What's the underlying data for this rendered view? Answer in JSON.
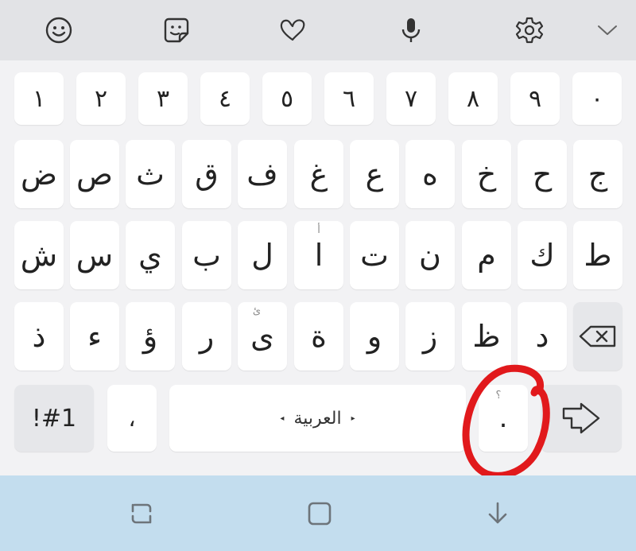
{
  "toolbar": {
    "icons": [
      "emoji-icon",
      "sticker-icon",
      "heart-doodle-icon",
      "microphone-icon",
      "settings-gear-icon",
      "collapse-chevron-icon"
    ]
  },
  "keyboard": {
    "numbers": [
      "١",
      "٢",
      "٣",
      "٤",
      "٥",
      "٦",
      "٧",
      "٨",
      "٩",
      "٠"
    ],
    "row1": [
      "ض",
      "ص",
      "ث",
      "ق",
      "ف",
      "غ",
      "ع",
      "ه",
      "خ",
      "ح",
      "ج"
    ],
    "row2": [
      "ش",
      "س",
      "ي",
      "ب",
      "ل",
      "ا",
      "ت",
      "ن",
      "م",
      "ك",
      "ط"
    ],
    "row2_hint_alef": "أ",
    "row3": [
      "ذ",
      "ء",
      "ؤ",
      "ر",
      "ى",
      "ة",
      "و",
      "ز",
      "ظ",
      "د"
    ],
    "row3_hint_ya": "ئ",
    "symbols_key": "!#1",
    "comma_key": "،",
    "space_label": "العربية",
    "period_key": ".",
    "period_hint": "؟"
  },
  "colors": {
    "annotation_circle": "#e1191c",
    "nav_bar": "#c3ddee",
    "toolbar": "#e2e3e6"
  },
  "navbar": {
    "icons": [
      "recent-apps-icon",
      "home-icon",
      "hide-keyboard-icon"
    ]
  }
}
